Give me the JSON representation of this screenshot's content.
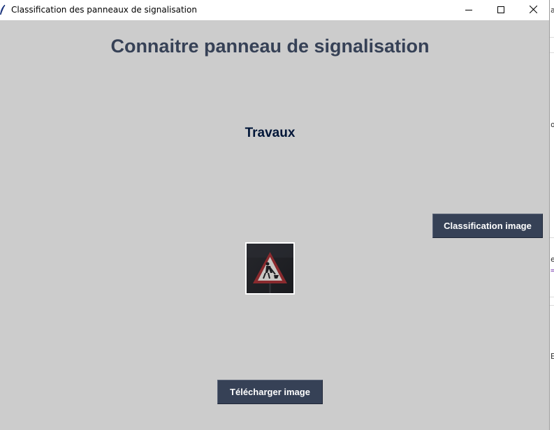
{
  "window": {
    "title": "Classification des panneaux de signalisation",
    "app_icon": "feather-icon",
    "controls": [
      "minimize-icon",
      "maximize-icon",
      "close-icon"
    ]
  },
  "main": {
    "heading": "Connaitre panneau de signalisation",
    "result_label": "Travaux",
    "classify_button": "Classification image",
    "upload_button": "Télécharger image",
    "uploaded_image": "roadworks-warning-sign-image"
  },
  "background_window": {
    "visible_chars": [
      "a",
      "o",
      "e",
      "=",
      "E"
    ]
  },
  "colors": {
    "background": "#cccccc",
    "heading": "#364156",
    "result": "#011638",
    "button_bg": "#364156",
    "button_text": "#ffffff"
  }
}
